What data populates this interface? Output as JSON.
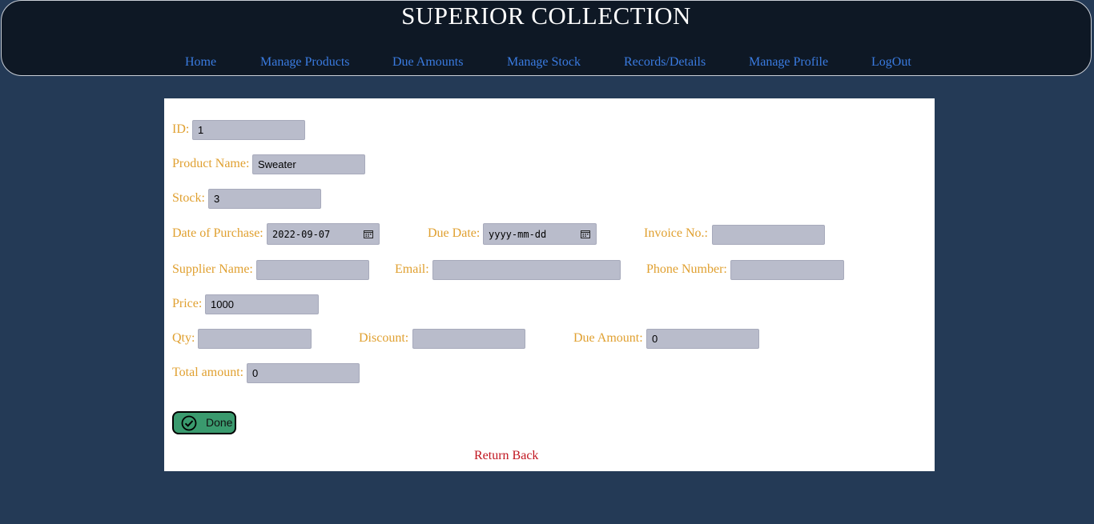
{
  "header": {
    "title": "SUPERIOR COLLECTION",
    "nav": [
      {
        "label": "Home"
      },
      {
        "label": "Manage Products"
      },
      {
        "label": "Due Amounts"
      },
      {
        "label": "Manage Stock"
      },
      {
        "label": "Records/Details"
      },
      {
        "label": "Manage Profile"
      },
      {
        "label": "LogOut"
      }
    ]
  },
  "form": {
    "id": {
      "label": "ID:",
      "value": "1"
    },
    "product_name": {
      "label": "Product Name:",
      "value": "Sweater"
    },
    "stock": {
      "label": "Stock:",
      "value": "3"
    },
    "date_of_purchase": {
      "label": "Date of Purchase:",
      "value": "2022-09-07"
    },
    "due_date": {
      "label": "Due Date:",
      "placeholder": "yyyy-mm-dd"
    },
    "invoice_no": {
      "label": "Invoice No.:",
      "value": ""
    },
    "supplier_name": {
      "label": "Supplier Name:",
      "value": ""
    },
    "email": {
      "label": "Email:",
      "value": ""
    },
    "phone_number": {
      "label": "Phone Number:",
      "value": ""
    },
    "price": {
      "label": "Price:",
      "value": "1000"
    },
    "qty": {
      "label": "Qty:",
      "value": ""
    },
    "discount": {
      "label": "Discount:",
      "value": ""
    },
    "due_amount": {
      "label": "Due Amount:",
      "value": "0"
    },
    "total_amount": {
      "label": "Total amount:",
      "value": "0"
    },
    "done_button": {
      "label": "Done",
      "icon": "check-circle-icon"
    },
    "return_link": "Return Back"
  },
  "colors": {
    "background": "#243a56",
    "header_bg": "#0e1825",
    "nav_link": "#3a7be0",
    "label": "#e0a030",
    "input_bg": "#b9bccb",
    "button_bg": "#3a9a6e",
    "return_link": "#c0141e"
  }
}
